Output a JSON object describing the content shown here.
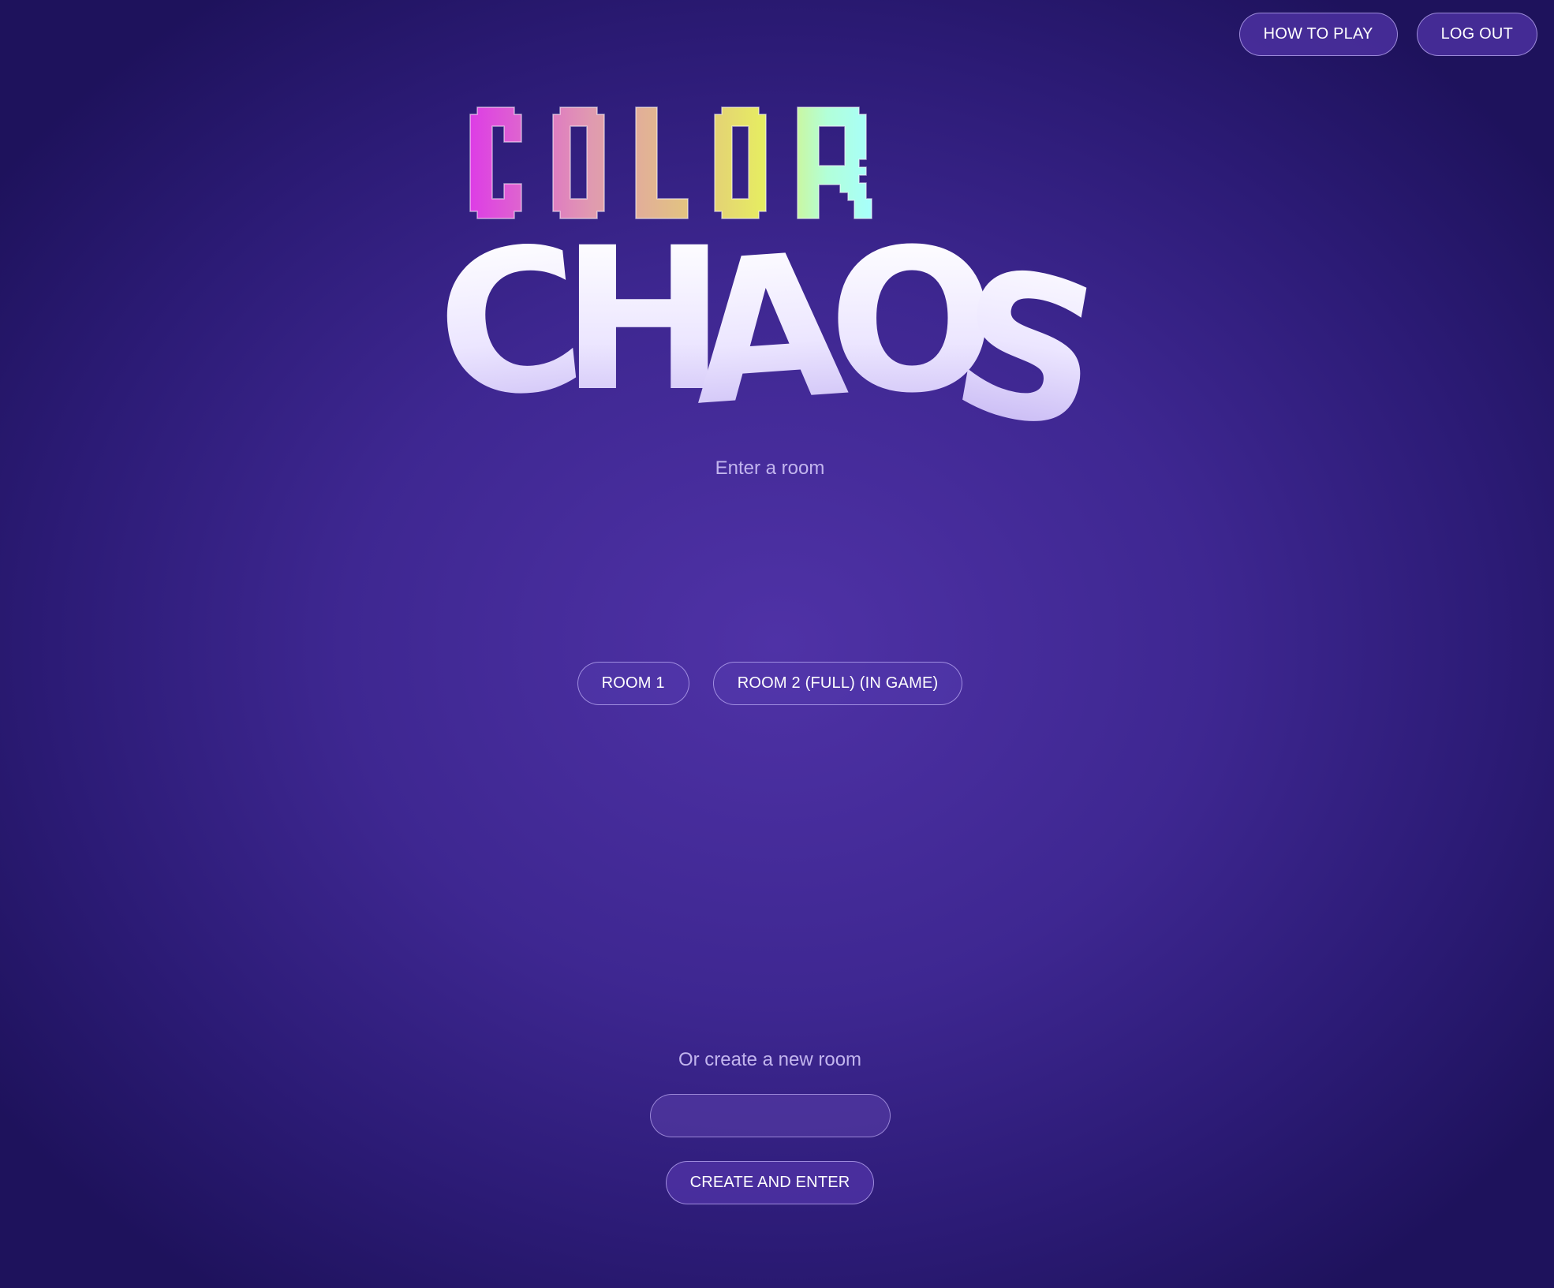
{
  "header": {
    "how_to_play_label": "HOW TO PLAY",
    "log_out_label": "LOG OUT"
  },
  "logo": {
    "word_top": "COLOR",
    "word_bottom": "CHAOS",
    "gradient_colors": [
      "#dd3ce6",
      "#e2a0a8",
      "#e5e866",
      "#a8fff0",
      "#a6ffff"
    ]
  },
  "enter_room": {
    "heading": "Enter a room",
    "rooms": [
      {
        "label": "ROOM 1"
      },
      {
        "label": "ROOM 2 (FULL) (IN GAME)"
      }
    ]
  },
  "create_room": {
    "heading": "Or create a new room",
    "input_value": "",
    "input_placeholder": "",
    "button_label": "CREATE AND ENTER"
  },
  "colors": {
    "background_center": "#4f32a6",
    "background_edge": "#1e125c",
    "subtitle_text": "#c2b5ee",
    "pill_border": "#cdbeff"
  }
}
